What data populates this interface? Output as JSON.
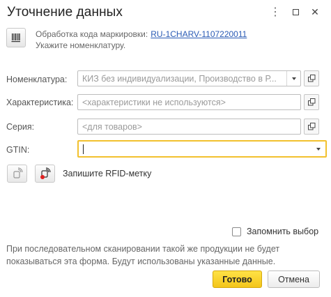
{
  "window": {
    "title": "Уточнение данных",
    "more_icon": "⋮",
    "close_icon": "✕"
  },
  "info": {
    "line1_prefix": "Обработка кода маркировки:",
    "line1_link": "RU-1CHARV-1107220011",
    "line2": "Укажите номенклатуру."
  },
  "fields": {
    "nomenclature": {
      "label": "Номенклатура:",
      "value": "КИЗ без индивидуализации, Производство в Р..."
    },
    "characteristic": {
      "label": "Характеристика:",
      "placeholder": "<характеристики не используются>"
    },
    "series": {
      "label": "Серия:",
      "placeholder": "<для товаров>"
    },
    "gtin": {
      "label": "GTIN:",
      "value": ""
    }
  },
  "rfid": {
    "label": "Запишите RFID-метку"
  },
  "remember": {
    "label": "Запомнить выбор",
    "checked": false
  },
  "note": "При последовательном сканировании такой же продукции не будет показываться эта форма. Будут использованы указанные данные.",
  "buttons": {
    "ok": "Готово",
    "cancel": "Отмена"
  },
  "colors": {
    "accent_yellow": "#f3c51a",
    "link_blue": "#2a5bb5",
    "focus_border": "#f2c12e"
  }
}
